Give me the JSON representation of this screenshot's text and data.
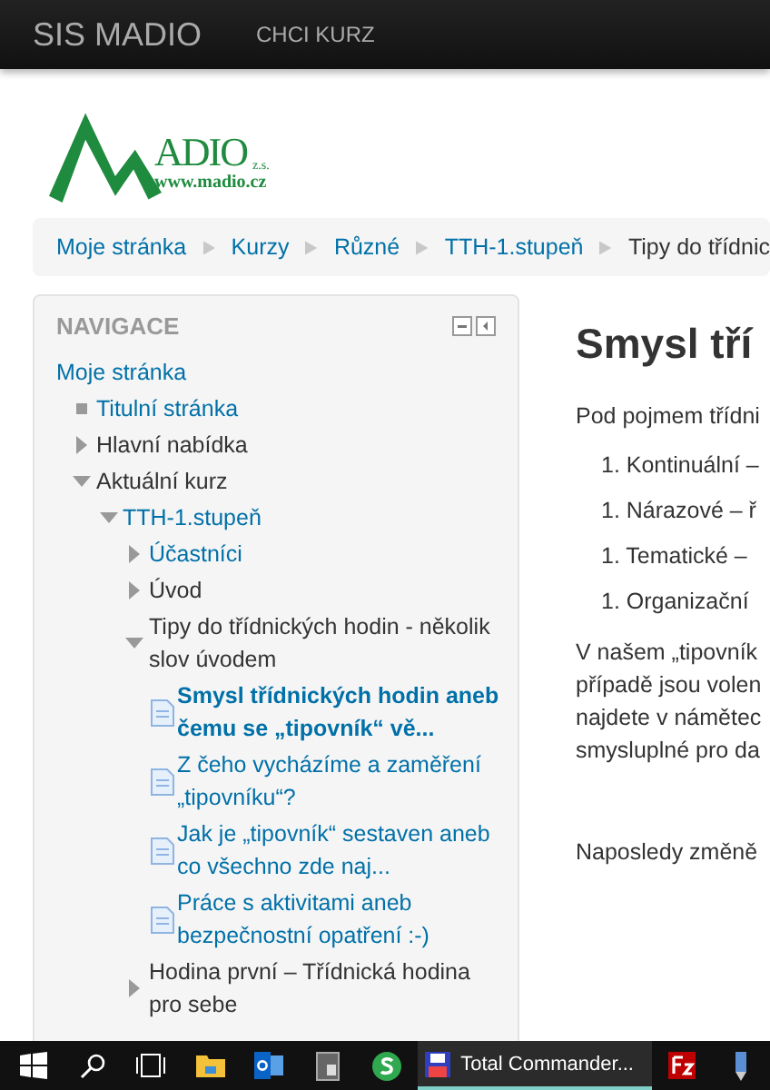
{
  "navbar": {
    "brand": "SIS MADIO",
    "links": [
      "CHCI KURZ"
    ]
  },
  "logo": {
    "name": "ADIO",
    "suffix": "z.s.",
    "url": "www.madio.cz"
  },
  "breadcrumb": [
    {
      "label": "Moje stránka",
      "link": true
    },
    {
      "label": "Kurzy",
      "link": true
    },
    {
      "label": "Různé",
      "link": true
    },
    {
      "label": "TTH-1.stupeň",
      "link": true
    },
    {
      "label": "Tipy do třídnic",
      "link": false
    }
  ],
  "navigation": {
    "title": "NAVIGACE",
    "items": [
      {
        "label": "Moje stránka",
        "kind": "root",
        "link": true,
        "current": false,
        "children": [
          {
            "label": "Titulní stránka",
            "kind": "leaf",
            "link": true,
            "current": false
          },
          {
            "label": "Hlavní nabídka",
            "kind": "branch",
            "expanded": false,
            "link": false,
            "current": false
          },
          {
            "label": "Aktuální kurz",
            "kind": "branch",
            "expanded": true,
            "link": false,
            "current": false,
            "children": [
              {
                "label": "TTH-1.stupeň",
                "kind": "branch",
                "expanded": true,
                "link": true,
                "current": false,
                "children": [
                  {
                    "label": "Účastníci",
                    "kind": "branch",
                    "expanded": false,
                    "link": true,
                    "current": false
                  },
                  {
                    "label": "Úvod",
                    "kind": "branch",
                    "expanded": false,
                    "link": false,
                    "current": false
                  },
                  {
                    "label": "Tipy do třídnických hodin - několik slov úvodem",
                    "kind": "branch",
                    "expanded": true,
                    "link": false,
                    "current": false,
                    "children": [
                      {
                        "label": "Smysl třídnických hodin aneb čemu se „tipovník“ vě...",
                        "kind": "page",
                        "link": true,
                        "current": true
                      },
                      {
                        "label": "Z čeho vycházíme a zaměření „tipovníku“?",
                        "kind": "page",
                        "link": true,
                        "current": false
                      },
                      {
                        "label": "Jak je „tipovník“ sestaven aneb co všechno zde naj...",
                        "kind": "page",
                        "link": true,
                        "current": false
                      },
                      {
                        "label": "Práce s aktivitami aneb bezpečnostní opatření :-)",
                        "kind": "page",
                        "link": true,
                        "current": false
                      }
                    ]
                  },
                  {
                    "label": "Hodina první – Třídnická hodina pro sebe",
                    "kind": "branch",
                    "expanded": false,
                    "link": false,
                    "current": false
                  }
                ]
              }
            ]
          }
        ]
      }
    ]
  },
  "main": {
    "heading": "Smysl tří",
    "intro": "Pod pojmem třídni",
    "list": [
      {
        "number": "1.",
        "text": "Kontinuální –"
      },
      {
        "number": "1.",
        "text": "Nárazové – ř"
      },
      {
        "number": "1.",
        "text": "Tematické –"
      },
      {
        "number": "1.",
        "text": "Organizační"
      }
    ],
    "paragraph": [
      "V našem „tipovník",
      "případě jsou volen",
      "najdete v námětec",
      "smysluplné pro da"
    ],
    "modified": "Naposledy změně"
  },
  "taskbar": [
    {
      "kind": "start"
    },
    {
      "kind": "search"
    },
    {
      "kind": "taskview"
    },
    {
      "kind": "folder"
    },
    {
      "kind": "outlook"
    },
    {
      "kind": "app"
    },
    {
      "kind": "skype"
    },
    {
      "kind": "window",
      "label": "Total Commander..."
    },
    {
      "kind": "filezilla"
    },
    {
      "kind": "pen"
    }
  ]
}
